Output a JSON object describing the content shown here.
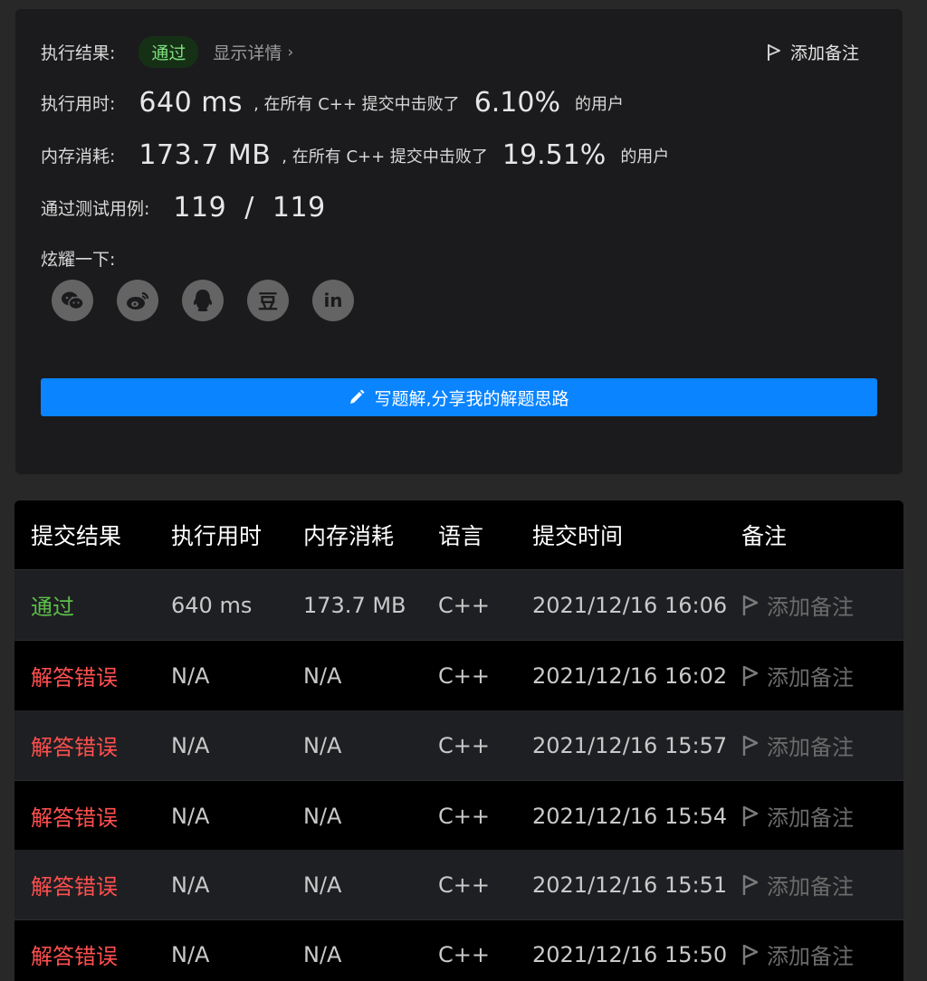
{
  "summary": {
    "result_label": "执行结果:",
    "result_badge": "通过",
    "details_link": "显示详情",
    "details_chevron": "›",
    "add_note": "添加备注",
    "time_label": "执行用时:",
    "time_value": "640 ms",
    "time_text": ", 在所有 C++ 提交中击败了",
    "time_pct": "6.10%",
    "time_suffix": "的用户",
    "mem_label": "内存消耗:",
    "mem_value": "173.7 MB",
    "mem_text": ", 在所有 C++ 提交中击败了",
    "mem_pct": "19.51%",
    "mem_suffix": "的用户",
    "cases_label": "通过测试用例:",
    "cases_value": "119  /  119",
    "share_label": "炫耀一下:",
    "share_icons": [
      "wechat-icon",
      "weibo-icon",
      "qq-icon",
      "douban-icon",
      "linkedin-icon"
    ],
    "douban_glyph": "豆",
    "linkedin_glyph": "in",
    "write_button": "写题解,分享我的解题思路"
  },
  "table": {
    "headers": [
      "提交结果",
      "执行用时",
      "内存消耗",
      "语言",
      "提交时间",
      "备注"
    ],
    "rows": [
      {
        "status": "通过",
        "ok": true,
        "time": "640 ms",
        "memory": "173.7 MB",
        "lang": "C++",
        "submitted": "2021/12/16 16:06",
        "note": "添加备注"
      },
      {
        "status": "解答错误",
        "ok": false,
        "time": "N/A",
        "memory": "N/A",
        "lang": "C++",
        "submitted": "2021/12/16 16:02",
        "note": "添加备注"
      },
      {
        "status": "解答错误",
        "ok": false,
        "time": "N/A",
        "memory": "N/A",
        "lang": "C++",
        "submitted": "2021/12/16 15:57",
        "note": "添加备注"
      },
      {
        "status": "解答错误",
        "ok": false,
        "time": "N/A",
        "memory": "N/A",
        "lang": "C++",
        "submitted": "2021/12/16 15:54",
        "note": "添加备注"
      },
      {
        "status": "解答错误",
        "ok": false,
        "time": "N/A",
        "memory": "N/A",
        "lang": "C++",
        "submitted": "2021/12/16 15:51",
        "note": "添加备注"
      },
      {
        "status": "解答错误",
        "ok": false,
        "time": "N/A",
        "memory": "N/A",
        "lang": "C++",
        "submitted": "2021/12/16 15:50",
        "note": "添加备注"
      }
    ]
  },
  "colors": {
    "accent": "#0a84ff",
    "success": "#5cbf4a",
    "error": "#ff4f4f"
  }
}
